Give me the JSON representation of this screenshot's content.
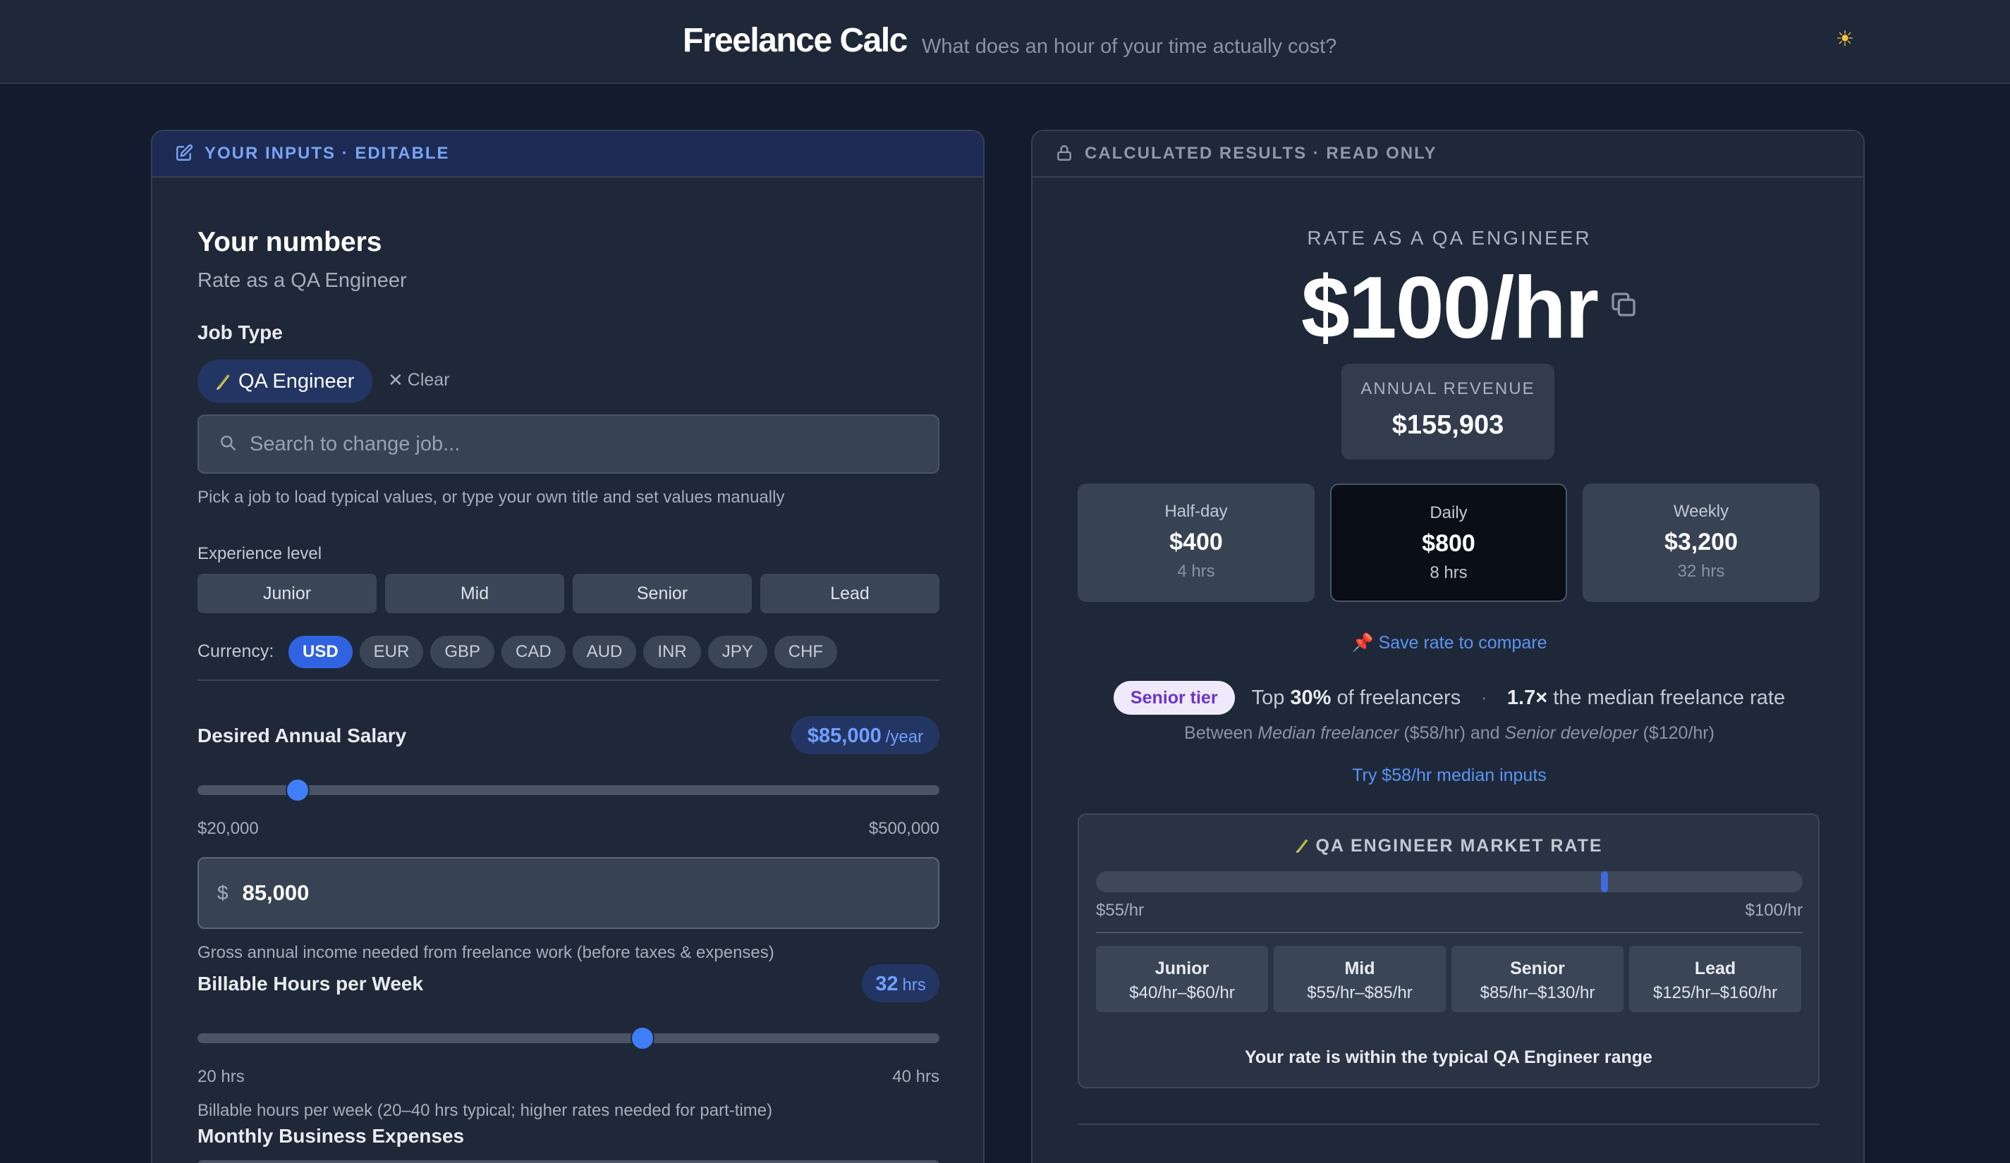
{
  "header": {
    "brand": "Freelance Calc",
    "tagline": "What does an hour of your time actually cost?",
    "theme_icon": "sun-icon"
  },
  "inputs_panel": {
    "header_label": "YOUR INPUTS · EDITABLE",
    "title": "Your numbers",
    "subtitle": "Rate as a QA Engineer",
    "job_type_label": "Job Type",
    "selected_job": "QA Engineer",
    "clear_label": "Clear",
    "search_placeholder": "Search to change job...",
    "job_hint": "Pick a job to load typical values, or type your own title and set values manually",
    "experience_label": "Experience level",
    "experience_levels": [
      "Junior",
      "Mid",
      "Senior",
      "Lead"
    ],
    "currency_label": "Currency:",
    "currencies": [
      "USD",
      "EUR",
      "GBP",
      "CAD",
      "AUD",
      "INR",
      "JPY",
      "CHF"
    ],
    "selected_currency": "USD",
    "salary": {
      "title": "Desired Annual Salary",
      "display_value": "$85,000",
      "display_unit": "/year",
      "slider_fraction": 0.1354,
      "min_label": "$20,000",
      "max_label": "$500,000",
      "currency_symbol": "$",
      "input_value": "85,000",
      "hint": "Gross annual income needed from freelance work (before taxes & expenses)"
    },
    "hours": {
      "title": "Billable Hours per Week",
      "display_value": "32",
      "display_unit": "hrs",
      "slider_fraction": 0.6,
      "min_label": "20 hrs",
      "max_label": "40 hrs",
      "hint": "Billable hours per week (20–40 hrs typical; higher rates needed for part-time)"
    },
    "expenses": {
      "title": "Monthly Business Expenses"
    }
  },
  "results_panel": {
    "header_label": "CALCULATED RESULTS · READ ONLY",
    "rate_title": "RATE AS A QA ENGINEER",
    "hourly_rate": "$100/hr",
    "annual_label": "ANNUAL REVENUE",
    "annual_value": "$155,903",
    "cards": [
      {
        "label": "Half-day",
        "value": "$400",
        "sub": "4 hrs"
      },
      {
        "label": "Daily",
        "value": "$800",
        "sub": "8 hrs"
      },
      {
        "label": "Weekly",
        "value": "$3,200",
        "sub": "32 hrs"
      }
    ],
    "save_link": "📌 Save rate to compare",
    "tier_badge": "Senior tier",
    "top_prefix": "Top",
    "top_percent": "30%",
    "top_suffix": "of freelancers",
    "median_multiple": "1.7×",
    "median_suffix": "the median freelance rate",
    "between_prefix": "Between",
    "between_a": "Median freelancer",
    "between_a_rate": "($58/hr) and",
    "between_b": "Senior developer",
    "between_b_rate": "($120/hr)",
    "try_link": "Try $58/hr median inputs",
    "market": {
      "title": "QA ENGINEER MARKET RATE",
      "min_label": "$55/hr",
      "max_label": "$100/hr",
      "marker_fraction": 0.72,
      "tiers": [
        {
          "name": "Junior",
          "range": "$40/hr–$60/hr"
        },
        {
          "name": "Mid",
          "range": "$55/hr–$85/hr"
        },
        {
          "name": "Senior",
          "range": "$85/hr–$130/hr"
        },
        {
          "name": "Lead",
          "range": "$125/hr–$160/hr"
        }
      ],
      "note": "Your rate is within the typical QA Engineer range"
    }
  },
  "colors": {
    "accent": "#3f7ef7",
    "background": "#131c2e",
    "panel": "#1f2838"
  }
}
